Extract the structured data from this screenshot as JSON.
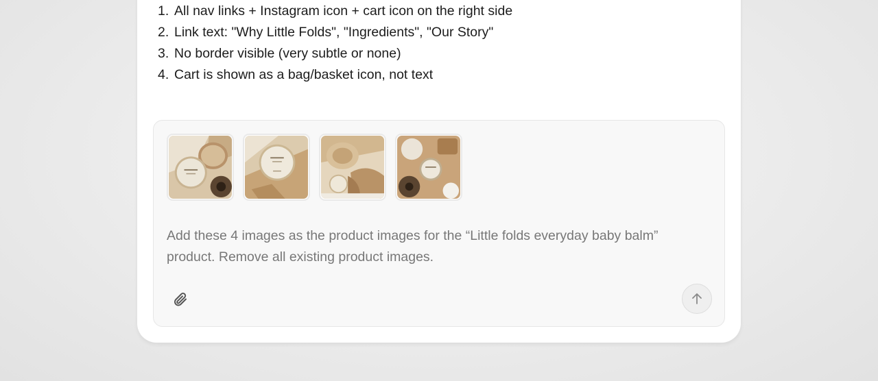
{
  "list": [
    {
      "num": "1.",
      "text": "All nav links + Instagram icon + cart icon on the right side"
    },
    {
      "num": "2.",
      "text": "Link text: \"Why Little Folds\", \"Ingredients\", \"Our Story\""
    },
    {
      "num": "3.",
      "text": "No border visible (very subtle or none)"
    },
    {
      "num": "4.",
      "text": "Cart is shown as a bag/basket icon, not text"
    }
  ],
  "composer": {
    "attachments": [
      {
        "label": "product-photo-1"
      },
      {
        "label": "product-photo-2"
      },
      {
        "label": "product-photo-3"
      },
      {
        "label": "product-photo-4"
      }
    ],
    "prompt_text": "Add these 4 images as the product images for the “Little folds everyday baby balm” product. Remove all existing product images.",
    "attach_icon": "paperclip-icon",
    "send_icon": "arrow-up-icon"
  },
  "colors": {
    "background": "#ebebeb",
    "card": "#ffffff",
    "composer": "#f8f8f8",
    "prompt_text": "#777777",
    "body_text": "#1c1c1c"
  }
}
